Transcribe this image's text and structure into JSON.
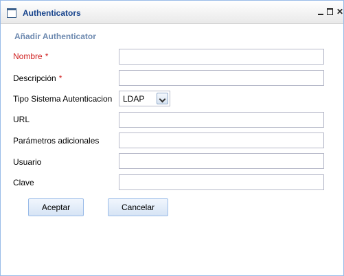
{
  "window": {
    "title": "Authenticators",
    "icon": "window-icon"
  },
  "form": {
    "section_title": "Añadir Authenticator",
    "fields": {
      "nombre": {
        "label": "Nombre",
        "required": true,
        "value": ""
      },
      "descripcion": {
        "label": "Descripción",
        "required": true,
        "value": ""
      },
      "tipo": {
        "label": "Tipo Sistema Autenticacion",
        "value": "LDAP"
      },
      "url": {
        "label": "URL",
        "value": ""
      },
      "parametros": {
        "label": "Parámetros adicionales",
        "value": ""
      },
      "usuario": {
        "label": "Usuario",
        "value": ""
      },
      "clave": {
        "label": "Clave",
        "value": ""
      }
    },
    "required_marker": "*"
  },
  "buttons": {
    "accept": "Aceptar",
    "cancel": "Cancelar"
  },
  "colors": {
    "required_label": "#d02020",
    "section_title": "#6e8ab0",
    "title_text": "#15428b"
  }
}
